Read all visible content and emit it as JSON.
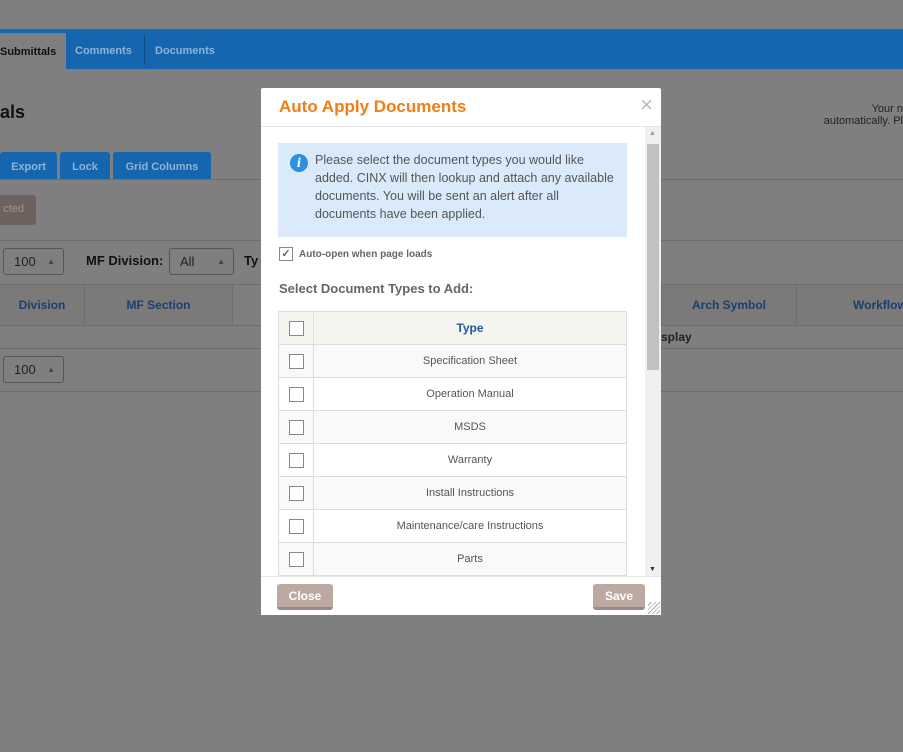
{
  "nav": {
    "tabs": [
      "Submittals",
      "Comments",
      "Documents"
    ]
  },
  "page": {
    "title": "als",
    "notice_line1": "Your n",
    "notice_line2": "automatically. Pl"
  },
  "toolbar": {
    "buttons": [
      "Export",
      "Lock",
      "Grid Columns"
    ],
    "selected_button": "cted"
  },
  "filters": {
    "page_size": "100",
    "mf_division_label": "MF Division:",
    "mf_division_value": "All",
    "type_label": "Ty"
  },
  "grid": {
    "columns": [
      "Division",
      "MF Section",
      "Arch Symbol",
      "Workflow"
    ],
    "row_text": "splay",
    "page_size": "100"
  },
  "modal": {
    "title": "Auto Apply Documents",
    "close_icon": "×",
    "info": "Please select the document types you would like added. CINX will then lookup and attach any available documents. You will be sent an alert after all documents have been applied.",
    "auto_open_label": "Auto-open when page loads",
    "auto_open_checked": true,
    "section_label": "Select Document Types to Add:",
    "table_header": "Type",
    "types": [
      "Specification Sheet",
      "Operation Manual",
      "MSDS",
      "Warranty",
      "Install Instructions",
      "Maintenance/care Instructions",
      "Parts"
    ],
    "close_label": "Close",
    "save_label": "Save"
  },
  "colors": {
    "accent": "#f07d15",
    "nav": "#1566ae",
    "button": "#bca9a2"
  }
}
